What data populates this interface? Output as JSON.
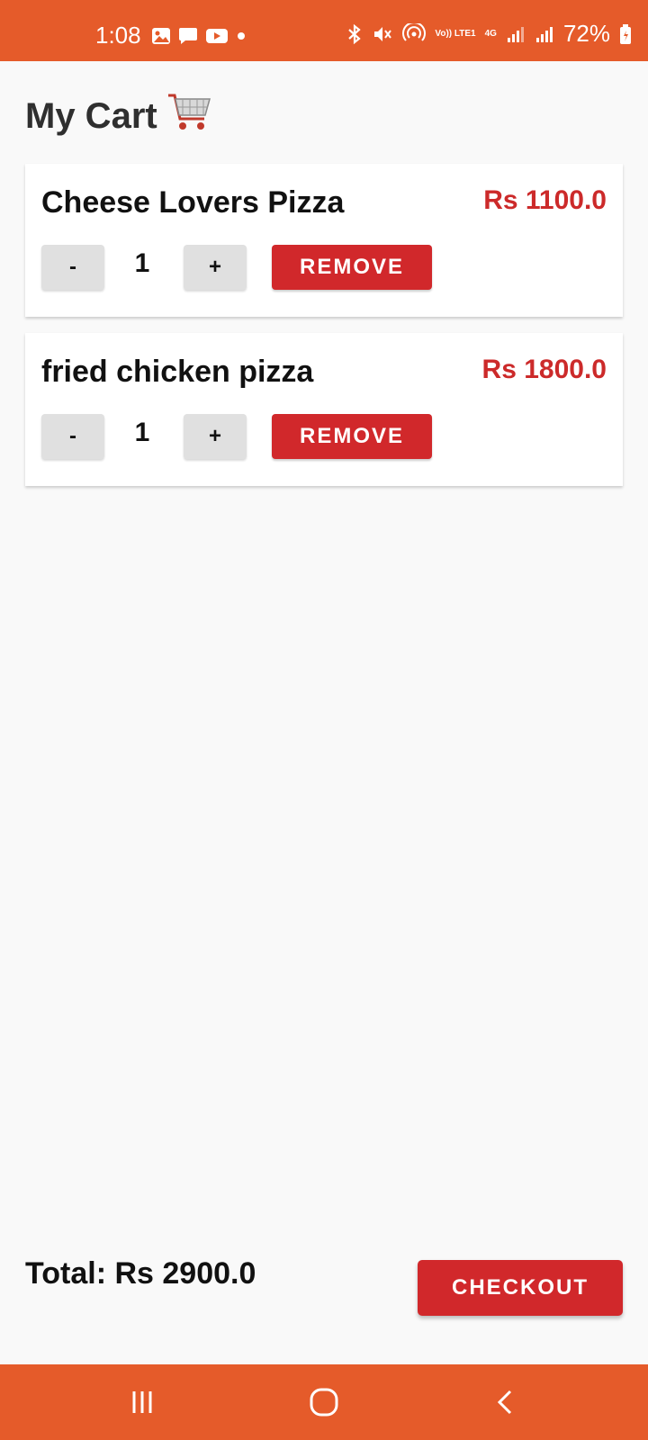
{
  "status_bar": {
    "time": "1:08",
    "battery": "72%",
    "network": "4G",
    "volte": "Vo)) LTE1",
    "icons": [
      "gallery-icon",
      "message-icon",
      "youtube-icon",
      "dot-icon",
      "bluetooth-icon",
      "mute-icon",
      "hotspot-icon",
      "signal-icon",
      "signal-icon",
      "battery-icon"
    ]
  },
  "page": {
    "title": "My Cart",
    "title_icon": "cart-icon"
  },
  "cart": {
    "items": [
      {
        "name": "Cheese Lovers Pizza",
        "price": "Rs 1100.0",
        "quantity": "1",
        "minus": "-",
        "plus": "+",
        "remove": "REMOVE"
      },
      {
        "name": "fried chicken pizza",
        "price": "Rs 1800.0",
        "quantity": "1",
        "minus": "-",
        "plus": "+",
        "remove": "REMOVE"
      }
    ]
  },
  "footer": {
    "total": "Total: Rs 2900.0",
    "checkout": "CHECKOUT"
  },
  "nav": {
    "icons": [
      "recent-apps-icon",
      "home-icon",
      "back-icon"
    ]
  },
  "colors": {
    "accent": "#e55b2a",
    "danger": "#d1282b",
    "price": "#cc2a2a",
    "background": "#f9f9f9"
  }
}
